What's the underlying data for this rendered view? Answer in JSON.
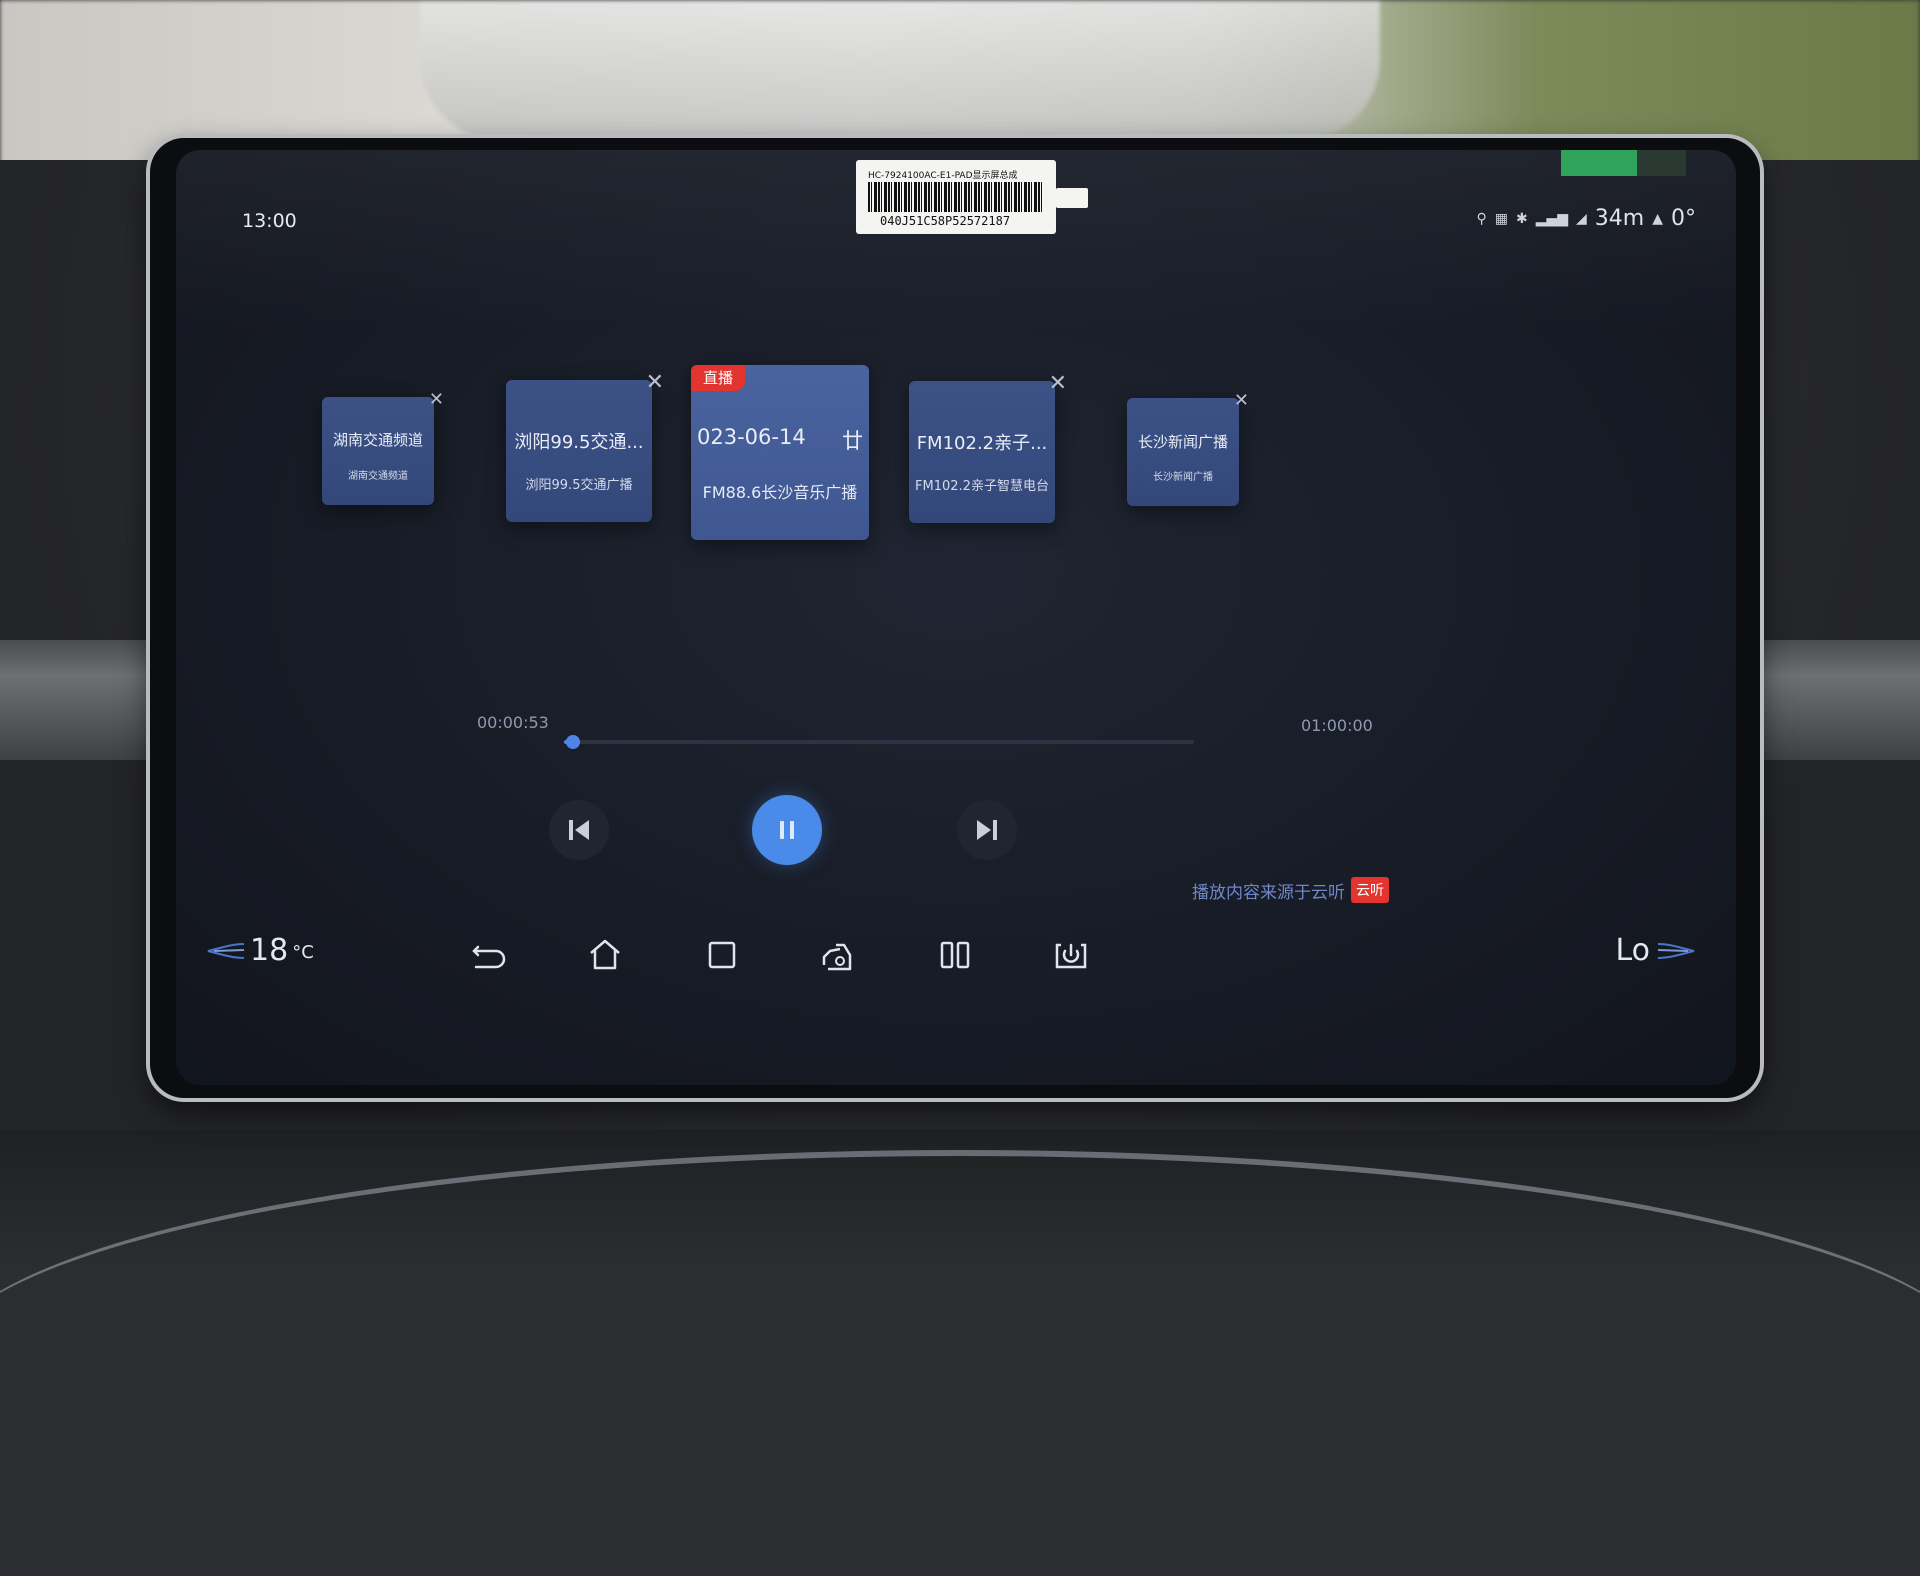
{
  "status": {
    "time": "13:00",
    "distance": "34m",
    "angle": "0°"
  },
  "sticker": {
    "part_code": "HC-7924100AC-E1-PAD显示屏总成",
    "serial": "040J51C58P52572187"
  },
  "stations": [
    {
      "title": "湖南交通频道",
      "subtitle": "湖南交通频道"
    },
    {
      "title": "浏阳99.5交通...",
      "subtitle": "浏阳99.5交通广播"
    },
    {
      "title": "023-06-14",
      "title_suffix": "廿",
      "subtitle": "FM88.6长沙音乐广播",
      "badge": "直播"
    },
    {
      "title": "FM102.2亲子...",
      "subtitle": "FM102.2亲子智慧电台"
    },
    {
      "title": "长沙新闻广播",
      "subtitle": "长沙新闻广播"
    }
  ],
  "player": {
    "elapsed": "00:00:53",
    "duration": "01:00:00",
    "progress_fraction": 0.015,
    "accent": "#4a8ae8"
  },
  "source": {
    "text": "播放内容来源于云听",
    "logo": "云听"
  },
  "climate": {
    "temperature": "18",
    "unit": "°C",
    "fan_right": "Lo"
  },
  "dock": [
    "back-icon",
    "home-icon",
    "recent-apps-icon",
    "car-settings-icon",
    "split-screen-icon",
    "power-icon"
  ]
}
